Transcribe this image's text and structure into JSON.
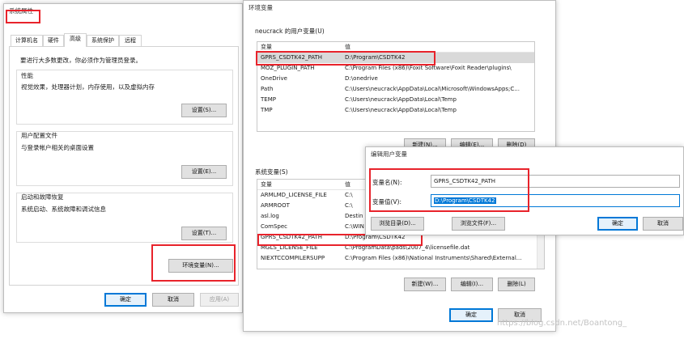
{
  "sysprops": {
    "title": "系统属性",
    "tabs": [
      "计算机名",
      "硬件",
      "高级",
      "系统保护",
      "远程"
    ],
    "admin_note": "要进行大多数更改，你必须作为管理员登录。",
    "perf": {
      "label": "性能",
      "desc": "视觉效果，处理器计划，内存使用，以及虚拟内存",
      "btn": "设置(S)..."
    },
    "profile": {
      "label": "用户配置文件",
      "desc": "与登录帐户相关的桌面设置",
      "btn": "设置(E)..."
    },
    "startup": {
      "label": "启动和故障恢复",
      "desc": "系统启动、系统故障和调试信息",
      "btn": "设置(T)..."
    },
    "env_btn": "环境变量(N)...",
    "ok": "确定",
    "cancel": "取消",
    "apply": "应用(A)"
  },
  "envvars": {
    "title": "环境变量",
    "user_label": "neucrack 的用户变量(U)",
    "col_var": "变量",
    "col_val": "值",
    "user_rows": [
      {
        "name": "GPRS_CSDTK42_PATH",
        "value": "D:\\Program\\CSDTK42"
      },
      {
        "name": "MOZ_PLUGIN_PATH",
        "value": "C:\\Program Files (x86)\\Foxit Software\\Foxit Reader\\plugins\\"
      },
      {
        "name": "OneDrive",
        "value": "D:\\onedrive"
      },
      {
        "name": "Path",
        "value": "C:\\Users\\neucrack\\AppData\\Local\\Microsoft\\WindowsApps;C..."
      },
      {
        "name": "TEMP",
        "value": "C:\\Users\\neucrack\\AppData\\Local\\Temp"
      },
      {
        "name": "TMP",
        "value": "C:\\Users\\neucrack\\AppData\\Local\\Temp"
      }
    ],
    "user_new": "新建(N)...",
    "user_edit": "编辑(E)...",
    "user_delete": "删除(D)",
    "sys_label": "系统变量(S)",
    "sys_rows": [
      {
        "name": "ARMLMD_LICENSE_FILE",
        "value": "C:\\"
      },
      {
        "name": "ARMROOT",
        "value": "C:\\"
      },
      {
        "name": "asl.log",
        "value": "Destin"
      },
      {
        "name": "ComSpec",
        "value": "C:\\WIN"
      },
      {
        "name": "GPRS_CSDTK42_PATH",
        "value": "D:\\Program\\CSDTK42"
      },
      {
        "name": "MGLS_LICENSE_FILE",
        "value": "C:\\ProgramData\\pads\\2007_4\\licensefile.dat"
      },
      {
        "name": "NIEXTCCOMPILERSUPP",
        "value": "C:\\Program Files (x86)\\National Instruments\\Shared\\External..."
      }
    ],
    "sys_new": "新建(W)...",
    "sys_edit": "编辑(I)...",
    "sys_delete": "删除(L)",
    "ok": "确定",
    "cancel": "取消"
  },
  "editdlg": {
    "title": "编辑用户变量",
    "name_label": "变量名(N):",
    "name_value": "GPRS_CSDTK42_PATH",
    "value_label": "变量值(V):",
    "value_value": "D:\\Program\\CSDTK42",
    "browse_dir": "浏览目录(D)...",
    "browse_file": "浏览文件(F)...",
    "ok": "确定",
    "cancel": "取消"
  },
  "watermark": "https://blog.csdn.net/Boantong_",
  "colors": {
    "annotation_red": "#e8232b",
    "selection_blue": "#0078d7"
  }
}
